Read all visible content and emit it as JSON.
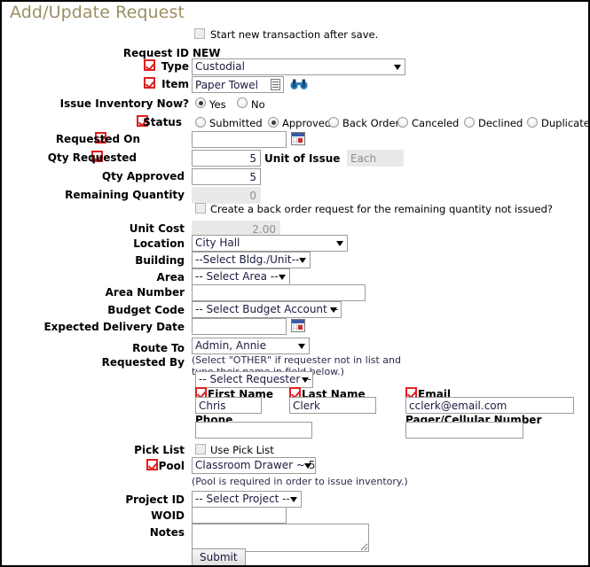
{
  "page": {
    "title": "Add/Update Request",
    "title_color": "#9a8f63",
    "required_marker_color": "#e02020"
  },
  "top": {
    "start_new_transaction_label": "Start new transaction after save.",
    "start_new_transaction_checked": false,
    "request_id_label": "Request ID",
    "request_id_value": "NEW"
  },
  "fields": {
    "type": {
      "label": "Type",
      "required": true,
      "value": "Custodial",
      "control": "select"
    },
    "item": {
      "label": "Item",
      "required": true,
      "value": "Paper Towel",
      "control": "text-with-picker",
      "picker_icon": "binoculars-icon",
      "inline_icon": "list-icon"
    },
    "issue_inventory_now": {
      "label": "Issue Inventory Now?",
      "required": false,
      "options": [
        "Yes",
        "No"
      ],
      "selected": "Yes"
    },
    "status": {
      "label": "Status",
      "required": true,
      "options": [
        "Submitted",
        "Approved",
        "Back Order",
        "Canceled",
        "Declined",
        "Duplicate"
      ],
      "selected": "Approved"
    },
    "requested_on": {
      "label": "Requested On",
      "required": true,
      "value": "",
      "control": "date",
      "icon": "calendar-icon"
    },
    "qty_requested": {
      "label": "Qty Requested",
      "required": true,
      "value": "5"
    },
    "unit_of_issue": {
      "label": "Unit of Issue",
      "required": false,
      "value": "Each",
      "disabled": true
    },
    "qty_approved": {
      "label": "Qty Approved",
      "required": false,
      "value": "5"
    },
    "remaining_quantity": {
      "label": "Remaining Quantity",
      "required": false,
      "value": "0",
      "disabled": true
    },
    "back_order": {
      "label": "Create a back order request for the remaining quantity not issued?",
      "checked": false
    },
    "unit_cost": {
      "label": "Unit Cost",
      "required": false,
      "value": "2.00",
      "disabled": true
    },
    "location": {
      "label": "Location",
      "required": false,
      "value": "City Hall",
      "control": "select"
    },
    "building": {
      "label": "Building",
      "required": false,
      "value": "--Select Bldg./Unit--",
      "control": "select"
    },
    "area": {
      "label": "Area",
      "required": false,
      "value": "-- Select Area --",
      "control": "select"
    },
    "area_number": {
      "label": "Area Number",
      "required": false,
      "value": ""
    },
    "budget_code": {
      "label": "Budget Code",
      "required": false,
      "value": "-- Select Budget Account --",
      "control": "select"
    },
    "expected_delivery_date": {
      "label": "Expected Delivery Date",
      "required": false,
      "value": "",
      "control": "date",
      "icon": "calendar-icon"
    },
    "route_to": {
      "label": "Route To",
      "required": false,
      "value": "Admin, Annie",
      "control": "select"
    },
    "requested_by": {
      "label": "Requested By",
      "hint": "(Select \"OTHER\" if requester not in list and\ntype their name in field below.)",
      "selector_value": "-- Select Requester --",
      "first_name": {
        "label": "First Name",
        "required": true,
        "value": "Chris"
      },
      "last_name": {
        "label": "Last Name",
        "required": true,
        "value": "Clerk"
      },
      "email": {
        "label": "Email",
        "required": true,
        "value": "cclerk@email.com"
      },
      "phone": {
        "label": "Phone",
        "required": false,
        "value": ""
      },
      "pager": {
        "label": "Pager/Cellular Number",
        "required": false,
        "value": ""
      }
    },
    "pick_list": {
      "label": "Pick List",
      "checkbox_label": "Use Pick List",
      "checked": false
    },
    "pool": {
      "label": "Pool",
      "required": true,
      "value": "Classroom Drawer ~ 5",
      "control": "select",
      "hint": "(Pool is required in order to issue inventory.)"
    },
    "project_id": {
      "label": "Project ID",
      "required": false,
      "value": "-- Select Project --",
      "control": "select"
    },
    "woid": {
      "label": "WOID",
      "required": false,
      "value": ""
    },
    "notes": {
      "label": "Notes",
      "required": false,
      "value": ""
    }
  },
  "actions": {
    "submit_label": "Submit"
  }
}
